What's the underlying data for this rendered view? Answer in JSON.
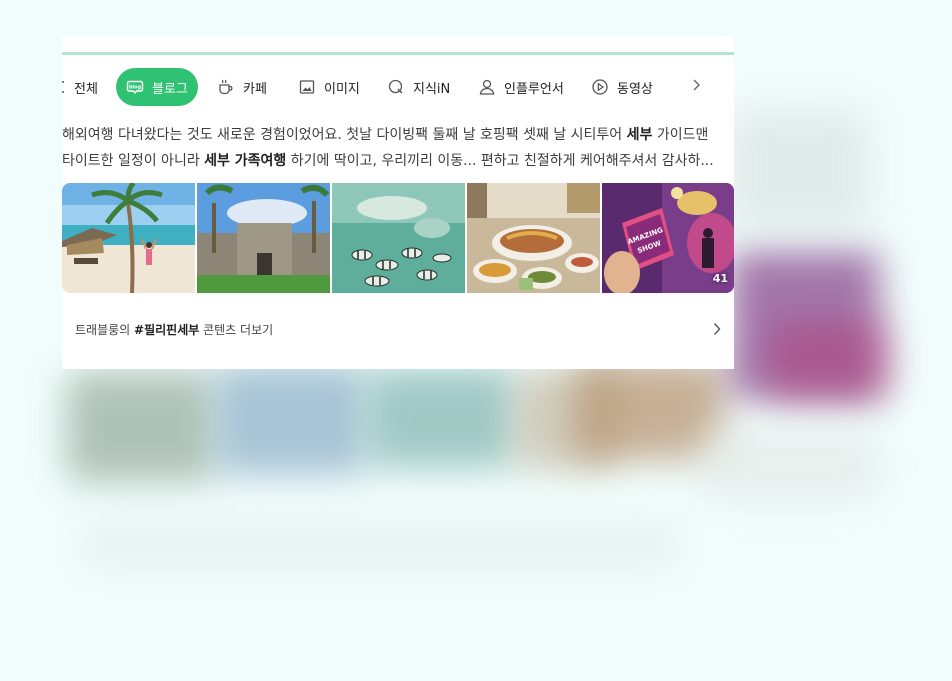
{
  "tabs": {
    "all": "전체",
    "blog": "블로그",
    "cafe": "카페",
    "image": "이미지",
    "kin": "지식iN",
    "influencer": "인플루언서",
    "video": "동영상"
  },
  "snippet": {
    "line1_a": "해외여행 다녀왔다는 것도 새로운 경험이었어요. 첫날 다이빙팩 둘째 날 호핑팩 셋째 날 시티투어 ",
    "line1_b": "세부",
    "line1_c": " 가이드맨",
    "line2_a": "타이트한 일정이 아니라 ",
    "line2_b": "세부 가족여행",
    "line2_c": " 하기에 딱이고, 우리끼리 이동... 편하고 친절하게 케어해주셔서 감사하..."
  },
  "images": {
    "count": "41"
  },
  "more": {
    "prefix": "트래블룽의 ",
    "hashtag": "#필리핀세부",
    "suffix": " 콘텐츠 더보기"
  },
  "colors": {
    "accent": "#30c273",
    "background": "#f1fdfc",
    "top_line": "#b4e4d3"
  },
  "icons": [
    "tab-scroll-left-icon",
    "blog-icon",
    "coffee-cup-icon",
    "image-icon",
    "kin-search-icon",
    "person-icon",
    "play-circle-icon",
    "chevron-right-icon"
  ]
}
